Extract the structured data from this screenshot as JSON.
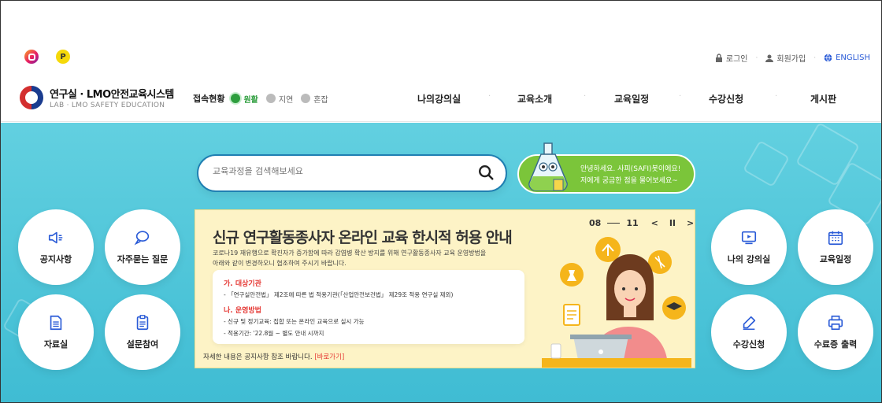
{
  "sns": {
    "instagram": "instagram-icon",
    "pay": "P"
  },
  "util": {
    "login": "로그인",
    "signup": "회원가입",
    "english": "ENGLISH"
  },
  "logo": {
    "title": "연구실 · LMO안전교육시스템",
    "subtitle": "LAB · LMO SAFETY EDUCATION"
  },
  "status": {
    "label": "접속현황",
    "items": [
      "원활",
      "지연",
      "혼잡"
    ]
  },
  "gnb": [
    "나의강의실",
    "교육소개",
    "교육일정",
    "수강신청",
    "게시판"
  ],
  "search": {
    "placeholder": "교육과정을 검색해보세요"
  },
  "chat": {
    "line1": "안녕하세요. 사피(SAFI)봇이에요!",
    "line2": "저에게 궁금한 점을 물어보세요~"
  },
  "quick_left": [
    "공지사항",
    "자주묻는 질문",
    "자료실",
    "설문참여"
  ],
  "quick_right": [
    "나의 강의실",
    "교육일정",
    "수강신청",
    "수료증 출력"
  ],
  "notice": {
    "title": "신규 연구활동종사자 온라인 교육 한시적 허용 안내",
    "desc1": "코로나19 재유행으로 확진자가 증가함에 따라 감염병 확산 방지를 위해 연구활동종사자 교육 운영방법을",
    "desc2": "아래와 같이 변경하오니 협조하여 주시기 바랍니다.",
    "h1": "가. 대상기관",
    "l1": "- 「연구실안전법」 제2조에 따른 법 적용기관(「산업안전보건법」 제29조 적용 연구실 제외)",
    "h2": "나. 운영방법",
    "l2": "- 신규 및 정기교육: 집합 또는 온라인 교육으로 실시 가능",
    "l3": "- 적용기간: '22.8월 ~ 별도 안내 시까지",
    "foot": "자세한 내용은 공지사항 참조 바랍니다.",
    "go": "[바로가기]"
  },
  "pager": {
    "current": "08",
    "total": "11",
    "prev": "<",
    "pause": "II",
    "next": ">"
  }
}
